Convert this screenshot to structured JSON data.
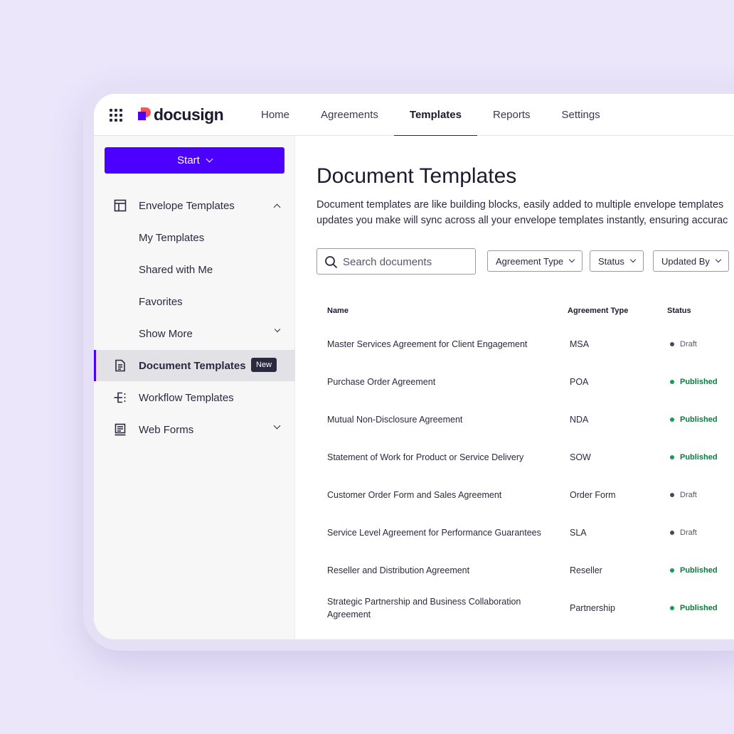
{
  "app": {
    "logo_text": "docusign"
  },
  "nav": {
    "items": [
      "Home",
      "Agreements",
      "Templates",
      "Reports",
      "Settings"
    ],
    "active": "Templates"
  },
  "sidebar": {
    "start_label": "Start",
    "envelope_templates": "Envelope Templates",
    "my_templates": "My Templates",
    "shared_with_me": "Shared with Me",
    "favorites": "Favorites",
    "show_more": "Show More",
    "document_templates": "Document Templates",
    "new_badge": "New",
    "workflow_templates": "Workflow Templates",
    "web_forms": "Web Forms"
  },
  "main": {
    "title": "Document Templates",
    "description_line1": "Document templates are like building blocks, easily added to multiple envelope templates",
    "description_line2": "updates you make will sync across all your envelope templates instantly, ensuring accurac",
    "search_placeholder": "Search documents",
    "filters": [
      "Agreement Type",
      "Status",
      "Updated By"
    ]
  },
  "table": {
    "headers": {
      "name": "Name",
      "type": "Agreement Type",
      "status": "Status"
    },
    "rows": [
      {
        "name": "Master Services Agreement for Client Engagement",
        "type": "MSA",
        "status": "Draft"
      },
      {
        "name": "Purchase Order Agreement",
        "type": "POA",
        "status": "Published"
      },
      {
        "name": "Mutual Non-Disclosure Agreement",
        "type": "NDA",
        "status": "Published"
      },
      {
        "name": "Statement of Work for Product or Service Delivery",
        "type": "SOW",
        "status": "Published"
      },
      {
        "name": "Customer Order Form and Sales Agreement",
        "type": "Order Form",
        "status": "Draft"
      },
      {
        "name": "Service Level Agreement for Performance Guarantees",
        "type": "SLA",
        "status": "Draft"
      },
      {
        "name": "Reseller and Distribution Agreement",
        "type": "Reseller",
        "status": "Published"
      },
      {
        "name": "Strategic Partnership and Business Collaboration Agreement",
        "type": "Partnership",
        "status": "Published"
      }
    ]
  },
  "colors": {
    "brand_purple": "#4c00ff",
    "brand_red": "#ff5252",
    "published_green": "#0a7a3e",
    "draft_gray": "#57556a"
  }
}
